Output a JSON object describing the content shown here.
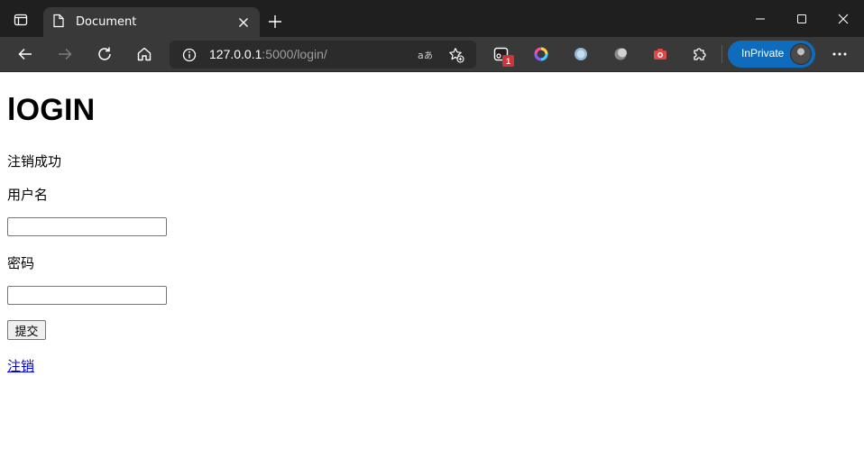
{
  "browser": {
    "tab": {
      "title": "Document"
    },
    "address": {
      "host": "127.0.0.1",
      "rest": ":5000/login/"
    },
    "extension_badge": "1",
    "profile_label": "InPrivate",
    "icons": {
      "tab_actions": "tab-actions-icon",
      "page": "document-icon",
      "close_tab": "close-icon",
      "new_tab": "plus-icon",
      "back": "back-arrow-icon",
      "forward": "forward-arrow-icon",
      "refresh": "refresh-icon",
      "home": "home-icon",
      "site_info": "info-icon",
      "read_aloud": "translate-icon",
      "favorites": "favorites-add-icon",
      "extensions": "puzzle-icon",
      "more": "more-icon"
    },
    "colors": {
      "frame": "#1f1f1f",
      "toolbar": "#393939",
      "inprivate": "#0f6cbd",
      "badge": "#d13438"
    }
  },
  "page": {
    "heading": "lOGIN",
    "message": "注销成功",
    "username_label": "用户名",
    "username_value": "",
    "password_label": "密码",
    "password_value": "",
    "submit_label": "提交",
    "logout_link": "注销",
    "link_color": "#0000ee"
  }
}
